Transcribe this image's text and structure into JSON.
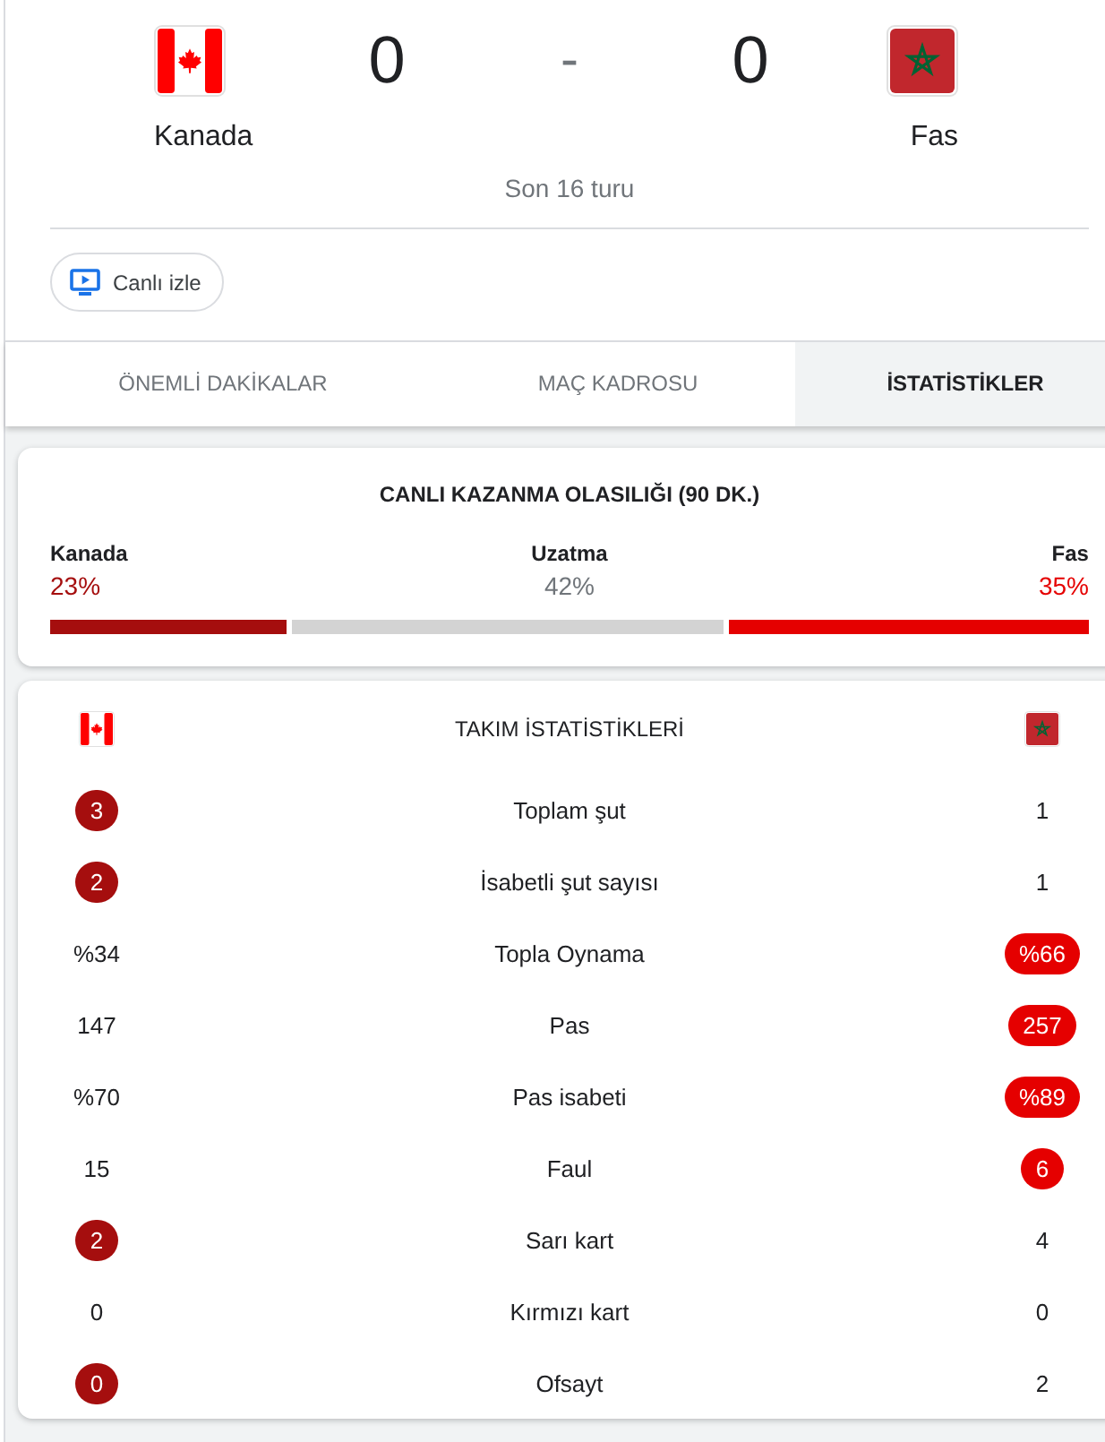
{
  "scoreboard": {
    "home": {
      "name": "Kanada",
      "score": "0"
    },
    "separator": "-",
    "away": {
      "name": "Fas",
      "score": "0"
    },
    "stage": "Son 16 turu"
  },
  "watch_button": {
    "label": "Canlı izle"
  },
  "tabs": [
    {
      "label": "ÖNEMLİ DAKİKALAR",
      "selected": false
    },
    {
      "label": "MAÇ KADROSU",
      "selected": false
    },
    {
      "label": "İSTATİSTİKLER",
      "selected": true
    }
  ],
  "win_probability": {
    "title": "CANLI KAZANMA OLASILIĞI (90 DK.)",
    "outcomes": [
      {
        "kind": "team",
        "label": "Kanada",
        "value": "23%",
        "level": 0.23,
        "color": "#a50e0e"
      },
      {
        "kind": "draw",
        "label": "Uzatma",
        "value": "42%",
        "level": 0.42,
        "color": "#d3d3d3"
      },
      {
        "kind": "team",
        "label": "Fas",
        "value": "35%",
        "level": 0.35,
        "color": "#e50000"
      }
    ]
  },
  "team_stats": {
    "title": "TAKIM İSTATİSTİKLERİ",
    "rows": [
      {
        "label": "Toplam şut",
        "home": {
          "value": "3",
          "highlighted": true
        },
        "away": {
          "value": "1",
          "highlighted": false
        }
      },
      {
        "label": "İsabetli şut sayısı",
        "home": {
          "value": "2",
          "highlighted": true
        },
        "away": {
          "value": "1",
          "highlighted": false
        }
      },
      {
        "label": "Topla Oynama",
        "home": {
          "value": "%34",
          "highlighted": false
        },
        "away": {
          "value": "%66",
          "highlighted": true
        }
      },
      {
        "label": "Pas",
        "home": {
          "value": "147",
          "highlighted": false
        },
        "away": {
          "value": "257",
          "highlighted": true
        }
      },
      {
        "label": "Pas isabeti",
        "home": {
          "value": "%70",
          "highlighted": false
        },
        "away": {
          "value": "%89",
          "highlighted": true
        }
      },
      {
        "label": "Faul",
        "home": {
          "value": "15",
          "highlighted": false
        },
        "away": {
          "value": "6",
          "highlighted": true
        }
      },
      {
        "label": "Sarı kart",
        "home": {
          "value": "2",
          "highlighted": true
        },
        "away": {
          "value": "4",
          "highlighted": false
        }
      },
      {
        "label": "Kırmızı kart",
        "home": {
          "value": "0",
          "highlighted": false
        },
        "away": {
          "value": "0",
          "highlighted": false
        }
      },
      {
        "label": "Ofsayt",
        "home": {
          "value": "0",
          "highlighted": true
        },
        "away": {
          "value": "2",
          "highlighted": false
        }
      }
    ]
  }
}
